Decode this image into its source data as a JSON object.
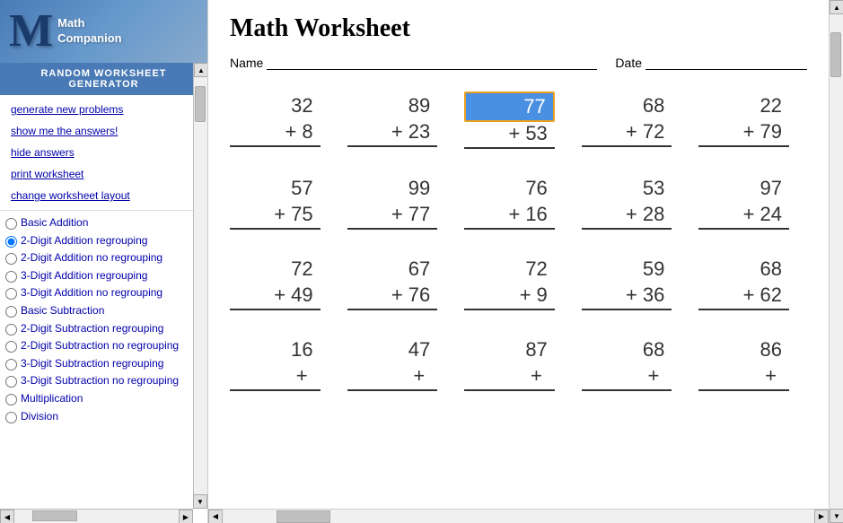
{
  "sidebar": {
    "logo_m": "M",
    "logo_line1": "Math",
    "logo_line2": "Companion",
    "title_line1": "RANDOM WORKSHEET",
    "title_line2": "GENERATOR",
    "menu": [
      {
        "id": "generate",
        "label": "generate new problems"
      },
      {
        "id": "show-answers",
        "label": "show me the answers!"
      },
      {
        "id": "hide-answers",
        "label": "hide answers"
      },
      {
        "id": "print",
        "label": "print worksheet"
      },
      {
        "id": "change-layout",
        "label": "change worksheet layout"
      }
    ],
    "options": [
      {
        "id": "basic-addition",
        "label": "Basic Addition",
        "checked": false
      },
      {
        "id": "2d-addition-regroup",
        "label": "2-Digit Addition regrouping",
        "checked": true
      },
      {
        "id": "2d-addition-no-regroup",
        "label": "2-Digit Addition no regrouping",
        "checked": false
      },
      {
        "id": "3d-addition-regroup",
        "label": "3-Digit Addition regrouping",
        "checked": false
      },
      {
        "id": "3d-addition-no-regroup",
        "label": "3-Digit Addition no regrouping",
        "checked": false
      },
      {
        "id": "basic-subtraction",
        "label": "Basic Subtraction",
        "checked": false
      },
      {
        "id": "2d-subtraction-regroup",
        "label": "2-Digit Subtraction regrouping",
        "checked": false
      },
      {
        "id": "2d-subtraction-no-regroup",
        "label": "2-Digit Subtraction no regrouping",
        "checked": false
      },
      {
        "id": "3d-subtraction-regroup",
        "label": "3-Digit Subtraction regrouping",
        "checked": false
      },
      {
        "id": "3d-subtraction-no-regroup",
        "label": "3-Digit Subtraction no regrouping",
        "checked": false
      },
      {
        "id": "multiplication",
        "label": "Multiplication",
        "checked": false
      },
      {
        "id": "division",
        "label": "Division",
        "checked": false
      }
    ]
  },
  "worksheet": {
    "title": "Math Worksheet",
    "name_label": "Name",
    "date_label": "Date",
    "problems": [
      {
        "top": "32",
        "op": "+",
        "bottom": "8",
        "highlighted": false
      },
      {
        "top": "89",
        "op": "+",
        "bottom": "23",
        "highlighted": false
      },
      {
        "top": "77",
        "op": "+",
        "bottom": "53",
        "highlighted": true
      },
      {
        "top": "68",
        "op": "+",
        "bottom": "72",
        "highlighted": false
      },
      {
        "top": "22",
        "op": "+",
        "bottom": "79",
        "highlighted": false
      },
      {
        "top": "57",
        "op": "+",
        "bottom": "75",
        "highlighted": false
      },
      {
        "top": "99",
        "op": "+",
        "bottom": "77",
        "highlighted": false
      },
      {
        "top": "76",
        "op": "+",
        "bottom": "16",
        "highlighted": false
      },
      {
        "top": "53",
        "op": "+",
        "bottom": "28",
        "highlighted": false
      },
      {
        "top": "97",
        "op": "+",
        "bottom": "24",
        "highlighted": false
      },
      {
        "top": "72",
        "op": "+",
        "bottom": "49",
        "highlighted": false
      },
      {
        "top": "67",
        "op": "+",
        "bottom": "76",
        "highlighted": false
      },
      {
        "top": "72",
        "op": "+",
        "bottom": "9",
        "highlighted": false
      },
      {
        "top": "59",
        "op": "+",
        "bottom": "36",
        "highlighted": false
      },
      {
        "top": "68",
        "op": "+",
        "bottom": "62",
        "highlighted": false
      },
      {
        "top": "16",
        "op": "+",
        "bottom": "??",
        "highlighted": false
      },
      {
        "top": "47",
        "op": "+",
        "bottom": "??",
        "highlighted": false
      },
      {
        "top": "87",
        "op": "+",
        "bottom": "??",
        "highlighted": false
      },
      {
        "top": "68",
        "op": "+",
        "bottom": "??",
        "highlighted": false
      },
      {
        "top": "86",
        "op": "+",
        "bottom": "??",
        "highlighted": false
      }
    ]
  },
  "icons": {
    "arrow_up": "▲",
    "arrow_down": "▼",
    "arrow_left": "◀",
    "arrow_right": "▶"
  }
}
